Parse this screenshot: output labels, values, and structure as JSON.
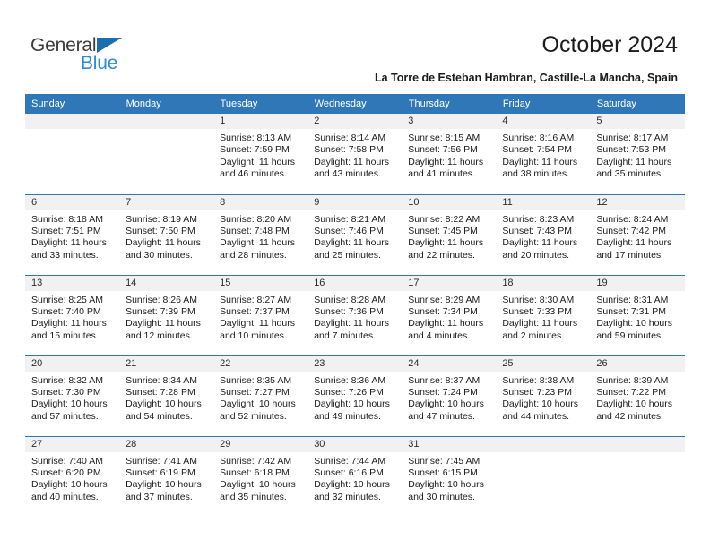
{
  "brand": {
    "name_top": "General",
    "name_bottom": "Blue"
  },
  "header": {
    "title": "October 2024",
    "subtitle": "La Torre de Esteban Hambran, Castille-La Mancha, Spain"
  },
  "colors": {
    "header_blue": "#3077b8",
    "logo_blue": "#2e8bd6",
    "daynum_band": "#f1f1f1"
  },
  "weekdays": [
    "Sunday",
    "Monday",
    "Tuesday",
    "Wednesday",
    "Thursday",
    "Friday",
    "Saturday"
  ],
  "weeks": [
    [
      {
        "day": "",
        "lines": []
      },
      {
        "day": "",
        "lines": []
      },
      {
        "day": "1",
        "lines": [
          "Sunrise: 8:13 AM",
          "Sunset: 7:59 PM",
          "Daylight: 11 hours",
          "and 46 minutes."
        ]
      },
      {
        "day": "2",
        "lines": [
          "Sunrise: 8:14 AM",
          "Sunset: 7:58 PM",
          "Daylight: 11 hours",
          "and 43 minutes."
        ]
      },
      {
        "day": "3",
        "lines": [
          "Sunrise: 8:15 AM",
          "Sunset: 7:56 PM",
          "Daylight: 11 hours",
          "and 41 minutes."
        ]
      },
      {
        "day": "4",
        "lines": [
          "Sunrise: 8:16 AM",
          "Sunset: 7:54 PM",
          "Daylight: 11 hours",
          "and 38 minutes."
        ]
      },
      {
        "day": "5",
        "lines": [
          "Sunrise: 8:17 AM",
          "Sunset: 7:53 PM",
          "Daylight: 11 hours",
          "and 35 minutes."
        ]
      }
    ],
    [
      {
        "day": "6",
        "lines": [
          "Sunrise: 8:18 AM",
          "Sunset: 7:51 PM",
          "Daylight: 11 hours",
          "and 33 minutes."
        ]
      },
      {
        "day": "7",
        "lines": [
          "Sunrise: 8:19 AM",
          "Sunset: 7:50 PM",
          "Daylight: 11 hours",
          "and 30 minutes."
        ]
      },
      {
        "day": "8",
        "lines": [
          "Sunrise: 8:20 AM",
          "Sunset: 7:48 PM",
          "Daylight: 11 hours",
          "and 28 minutes."
        ]
      },
      {
        "day": "9",
        "lines": [
          "Sunrise: 8:21 AM",
          "Sunset: 7:46 PM",
          "Daylight: 11 hours",
          "and 25 minutes."
        ]
      },
      {
        "day": "10",
        "lines": [
          "Sunrise: 8:22 AM",
          "Sunset: 7:45 PM",
          "Daylight: 11 hours",
          "and 22 minutes."
        ]
      },
      {
        "day": "11",
        "lines": [
          "Sunrise: 8:23 AM",
          "Sunset: 7:43 PM",
          "Daylight: 11 hours",
          "and 20 minutes."
        ]
      },
      {
        "day": "12",
        "lines": [
          "Sunrise: 8:24 AM",
          "Sunset: 7:42 PM",
          "Daylight: 11 hours",
          "and 17 minutes."
        ]
      }
    ],
    [
      {
        "day": "13",
        "lines": [
          "Sunrise: 8:25 AM",
          "Sunset: 7:40 PM",
          "Daylight: 11 hours",
          "and 15 minutes."
        ]
      },
      {
        "day": "14",
        "lines": [
          "Sunrise: 8:26 AM",
          "Sunset: 7:39 PM",
          "Daylight: 11 hours",
          "and 12 minutes."
        ]
      },
      {
        "day": "15",
        "lines": [
          "Sunrise: 8:27 AM",
          "Sunset: 7:37 PM",
          "Daylight: 11 hours",
          "and 10 minutes."
        ]
      },
      {
        "day": "16",
        "lines": [
          "Sunrise: 8:28 AM",
          "Sunset: 7:36 PM",
          "Daylight: 11 hours",
          "and 7 minutes."
        ]
      },
      {
        "day": "17",
        "lines": [
          "Sunrise: 8:29 AM",
          "Sunset: 7:34 PM",
          "Daylight: 11 hours",
          "and 4 minutes."
        ]
      },
      {
        "day": "18",
        "lines": [
          "Sunrise: 8:30 AM",
          "Sunset: 7:33 PM",
          "Daylight: 11 hours",
          "and 2 minutes."
        ]
      },
      {
        "day": "19",
        "lines": [
          "Sunrise: 8:31 AM",
          "Sunset: 7:31 PM",
          "Daylight: 10 hours",
          "and 59 minutes."
        ]
      }
    ],
    [
      {
        "day": "20",
        "lines": [
          "Sunrise: 8:32 AM",
          "Sunset: 7:30 PM",
          "Daylight: 10 hours",
          "and 57 minutes."
        ]
      },
      {
        "day": "21",
        "lines": [
          "Sunrise: 8:34 AM",
          "Sunset: 7:28 PM",
          "Daylight: 10 hours",
          "and 54 minutes."
        ]
      },
      {
        "day": "22",
        "lines": [
          "Sunrise: 8:35 AM",
          "Sunset: 7:27 PM",
          "Daylight: 10 hours",
          "and 52 minutes."
        ]
      },
      {
        "day": "23",
        "lines": [
          "Sunrise: 8:36 AM",
          "Sunset: 7:26 PM",
          "Daylight: 10 hours",
          "and 49 minutes."
        ]
      },
      {
        "day": "24",
        "lines": [
          "Sunrise: 8:37 AM",
          "Sunset: 7:24 PM",
          "Daylight: 10 hours",
          "and 47 minutes."
        ]
      },
      {
        "day": "25",
        "lines": [
          "Sunrise: 8:38 AM",
          "Sunset: 7:23 PM",
          "Daylight: 10 hours",
          "and 44 minutes."
        ]
      },
      {
        "day": "26",
        "lines": [
          "Sunrise: 8:39 AM",
          "Sunset: 7:22 PM",
          "Daylight: 10 hours",
          "and 42 minutes."
        ]
      }
    ],
    [
      {
        "day": "27",
        "lines": [
          "Sunrise: 7:40 AM",
          "Sunset: 6:20 PM",
          "Daylight: 10 hours",
          "and 40 minutes."
        ]
      },
      {
        "day": "28",
        "lines": [
          "Sunrise: 7:41 AM",
          "Sunset: 6:19 PM",
          "Daylight: 10 hours",
          "and 37 minutes."
        ]
      },
      {
        "day": "29",
        "lines": [
          "Sunrise: 7:42 AM",
          "Sunset: 6:18 PM",
          "Daylight: 10 hours",
          "and 35 minutes."
        ]
      },
      {
        "day": "30",
        "lines": [
          "Sunrise: 7:44 AM",
          "Sunset: 6:16 PM",
          "Daylight: 10 hours",
          "and 32 minutes."
        ]
      },
      {
        "day": "31",
        "lines": [
          "Sunrise: 7:45 AM",
          "Sunset: 6:15 PM",
          "Daylight: 10 hours",
          "and 30 minutes."
        ]
      },
      {
        "day": "",
        "lines": []
      },
      {
        "day": "",
        "lines": []
      }
    ]
  ]
}
